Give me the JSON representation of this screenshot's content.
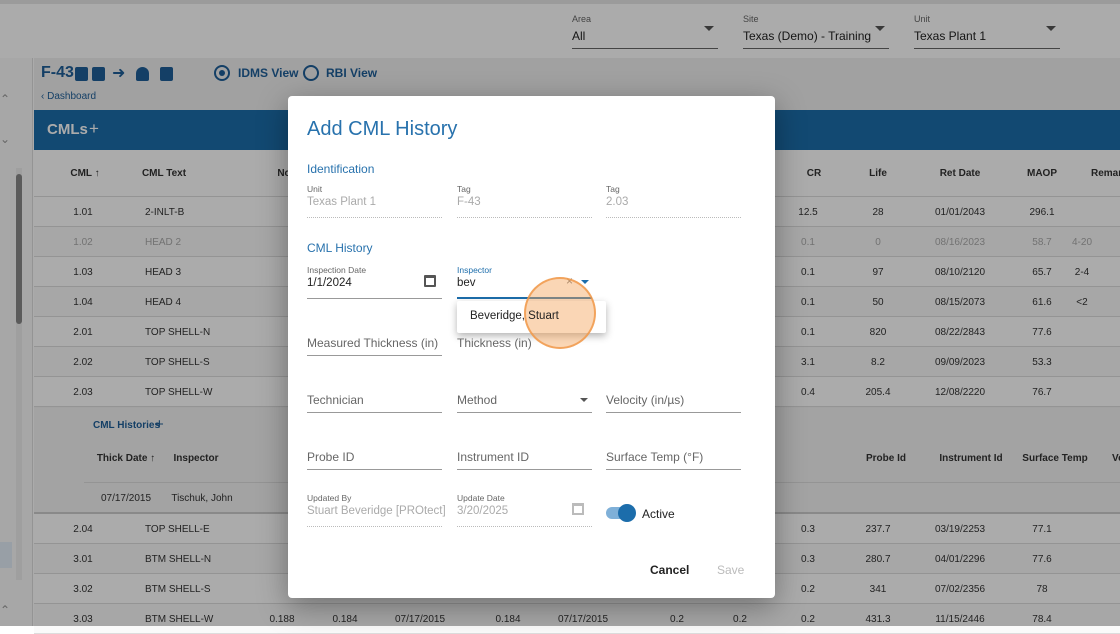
{
  "filters": [
    {
      "label": "Area",
      "value": "All"
    },
    {
      "label": "Site",
      "value": "Texas (Demo) - Training"
    },
    {
      "label": "Unit",
      "value": "Texas Plant 1"
    }
  ],
  "header": {
    "tag": "F-43",
    "view_idms": "IDMS View",
    "view_rbi": "RBI View",
    "breadcrumb": "Dashboard",
    "section": "CMLs",
    "add": "+"
  },
  "cml_table": {
    "columns": [
      "CML ↑",
      "CML Text",
      "No",
      "CR",
      "Life",
      "Ret Date",
      "MAOP",
      "Remark"
    ],
    "rows": [
      {
        "cml": "1.01",
        "text": "2-INLT-B",
        "cr": "12.5",
        "life": "28",
        "ret": "01/01/2043",
        "maop": "296.1",
        "remark": ""
      },
      {
        "cml": "1.02",
        "text": "HEAD 2",
        "cr": "0.1",
        "life": "0",
        "ret": "08/16/2023",
        "maop": "58.7",
        "remark": "4-20"
      },
      {
        "cml": "1.03",
        "text": "HEAD 3",
        "cr": "0.1",
        "life": "97",
        "ret": "08/10/2120",
        "maop": "65.7",
        "remark": "2-4"
      },
      {
        "cml": "1.04",
        "text": "HEAD 4",
        "cr": "0.1",
        "life": "50",
        "ret": "08/15/2073",
        "maop": "61.6",
        "remark": "<2"
      },
      {
        "cml": "2.01",
        "text": "TOP SHELL-N",
        "cr": "0.1",
        "life": "820",
        "ret": "08/22/2843",
        "maop": "77.6",
        "remark": ""
      },
      {
        "cml": "2.02",
        "text": "TOP SHELL-S",
        "cr": "3.1",
        "life": "8.2",
        "ret": "09/09/2023",
        "maop": "53.3",
        "remark": ""
      },
      {
        "cml": "2.03",
        "text": "TOP SHELL-W",
        "cr": "0.4",
        "life": "205.4",
        "ret": "12/08/2220",
        "maop": "76.7",
        "remark": ""
      }
    ],
    "rows_after": [
      {
        "cml": "2.04",
        "text": "TOP SHELL-E",
        "cr": "0.3",
        "life": "237.7",
        "ret": "03/19/2253",
        "maop": "77.1"
      },
      {
        "cml": "3.01",
        "text": "BTM SHELL-N",
        "cr": "0.3",
        "life": "280.7",
        "ret": "04/01/2296",
        "maop": "77.6"
      },
      {
        "cml": "3.02",
        "text": "BTM SHELL-S",
        "cr": "0.2",
        "life": "341",
        "ret": "07/02/2356",
        "maop": "78"
      },
      {
        "cml": "3.03",
        "text": "BTM SHELL-W",
        "c1": "0.188",
        "c2": "0.184",
        "c3": "07/17/2015",
        "c4": "0.184",
        "c5": "07/17/2015",
        "c6": "0.2",
        "c7": "0.2",
        "cr": "0.2",
        "life": "431.3",
        "ret": "11/15/2446",
        "maop": "78.4"
      }
    ]
  },
  "histories": {
    "title": "CML Histories",
    "add": "+",
    "columns": [
      "Thick Date ↑",
      "Inspector",
      "Probe Id",
      "Instrument Id",
      "Surface Temp",
      "Ve"
    ],
    "row": {
      "date": "07/17/2015",
      "inspector": "Tischuk, John"
    }
  },
  "modal": {
    "title": "Add CML History",
    "identification": "Identification",
    "unit": {
      "label": "Unit",
      "value": "Texas Plant 1"
    },
    "tag": {
      "label": "Tag",
      "value": "F-43"
    },
    "tag2": {
      "label": "Tag",
      "value": "2.03"
    },
    "history": "CML History",
    "inspection_date": {
      "label": "Inspection Date",
      "value": "1/1/2024"
    },
    "inspector": {
      "label": "Inspector",
      "value": "bev",
      "option_match": "Beveridge,",
      "option_rest": " Stuart"
    },
    "measured_thickness": "Measured Thickness (in)",
    "thickness": "Thickness (in)",
    "technician": "Technician",
    "method": "Method",
    "velocity": "Velocity (in/µs)",
    "probe_id": "Probe ID",
    "instrument_id": "Instrument ID",
    "surface_temp": "Surface Temp (°F)",
    "updated_by": {
      "label": "Updated By",
      "value": "Stuart Beveridge [PROtect]"
    },
    "update_date": {
      "label": "Update Date",
      "value": "3/20/2025"
    },
    "active": {
      "label": "Active",
      "on": true
    },
    "cancel": "Cancel",
    "save": "Save"
  },
  "colors": {
    "accent": "#1c6dab",
    "highlight": "#f5a45a"
  }
}
